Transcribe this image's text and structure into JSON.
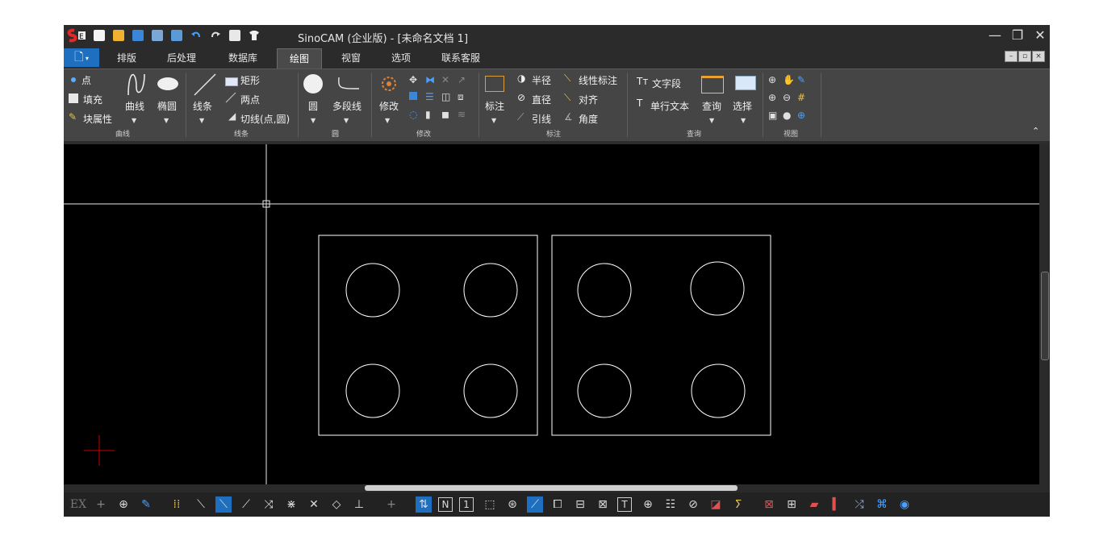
{
  "window": {
    "title": "SinoCAM (企业版) - [未命名文档 1]"
  },
  "window_controls": {
    "minimize": "—",
    "restore": "❐",
    "close": "✕"
  },
  "file_button": "🗋",
  "tabs": [
    {
      "label": "排版"
    },
    {
      "label": "后处理"
    },
    {
      "label": "数据库"
    },
    {
      "label": "绘图",
      "active": true
    },
    {
      "label": "视窗"
    },
    {
      "label": "选项"
    },
    {
      "label": "联系客服"
    }
  ],
  "ribbon": {
    "curve_group": {
      "point": "点",
      "fill": "填充",
      "block_attr": "块属性",
      "curve": "曲线",
      "ellipse": "椭圆",
      "caption": "曲线"
    },
    "line_group": {
      "line": "线条",
      "rect": "矩形",
      "two_point": "两点",
      "tangent": "切线(点,圆)",
      "caption": "线条"
    },
    "circle_group": {
      "circle": "圆",
      "polyline": "多段线",
      "caption": "圆"
    },
    "modify_group": {
      "modify": "修改",
      "caption": "修改"
    },
    "annot_group": {
      "annotate": "标注",
      "radius": "半径",
      "diameter": "直径",
      "leader": "引线",
      "linear": "线性标注",
      "align": "对齐",
      "angle": "角度",
      "caption": "标注"
    },
    "query_group": {
      "text_para": "文字段",
      "single_text": "单行文本",
      "query": "查询",
      "select": "选择",
      "caption": "查询"
    },
    "view_group": {
      "caption": "视图"
    }
  },
  "statusbar": {
    "ex_label": "EX",
    "n_label": "N",
    "one_label": "1",
    "t_label": "T"
  },
  "colors": {
    "accent": "#1e6fc0",
    "canvas": "#000000",
    "cursor": "#cc0000"
  }
}
